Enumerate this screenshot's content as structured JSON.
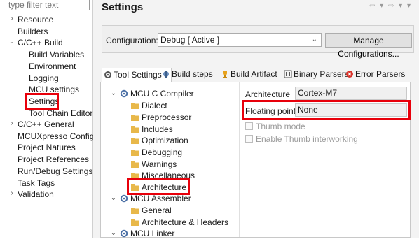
{
  "filter": {
    "placeholder": "type filter text"
  },
  "nav": {
    "items": [
      {
        "label": "Resource",
        "expander": "›"
      },
      {
        "label": "Builders"
      },
      {
        "label": "C/C++ Build",
        "expander": "⌄"
      },
      {
        "label": "Build Variables"
      },
      {
        "label": "Environment"
      },
      {
        "label": "Logging"
      },
      {
        "label": "MCU settings"
      },
      {
        "label": "Settings"
      },
      {
        "label": "Tool Chain Editor"
      },
      {
        "label": "C/C++ General",
        "expander": "›"
      },
      {
        "label": "MCUXpresso Config T"
      },
      {
        "label": "Project Natures"
      },
      {
        "label": "Project References"
      },
      {
        "label": "Run/Debug Settings"
      },
      {
        "label": "Task Tags"
      },
      {
        "label": "Validation",
        "expander": "›"
      }
    ]
  },
  "header": {
    "title": "Settings",
    "nav_icons": "⇦ ▾ ⇨ ▾ ▾"
  },
  "config": {
    "label": "Configuration:",
    "selected": "Debug  [ Active ]",
    "manage_label": "Manage Configurations..."
  },
  "tabs": [
    {
      "label": "Tool Settings",
      "icon": "settings-icon"
    },
    {
      "label": "Build steps",
      "icon": "build-steps-icon"
    },
    {
      "label": "Build Artifact",
      "icon": "trophy-icon"
    },
    {
      "label": "Binary Parsers",
      "icon": "binary-icon"
    },
    {
      "label": "Error Parsers",
      "icon": "error-icon"
    }
  ],
  "tree": {
    "items": [
      {
        "label": "MCU C Compiler",
        "expander": "⌄"
      },
      {
        "label": "Dialect"
      },
      {
        "label": "Preprocessor"
      },
      {
        "label": "Includes"
      },
      {
        "label": "Optimization"
      },
      {
        "label": "Debugging"
      },
      {
        "label": "Warnings"
      },
      {
        "label": "Miscellaneous"
      },
      {
        "label": "Architecture"
      },
      {
        "label": "MCU Assembler",
        "expander": "⌄"
      },
      {
        "label": "General"
      },
      {
        "label": "Architecture & Headers"
      },
      {
        "label": "MCU Linker",
        "expander": "⌄"
      }
    ]
  },
  "props": {
    "architecture_label": "Architecture",
    "architecture_value": "Cortex-M7",
    "floating_label": "Floating point",
    "floating_value": "None",
    "thumb_label": "Thumb mode",
    "interwork_label": "Enable Thumb interworking"
  },
  "colors": {
    "highlight": "#e8000b",
    "folder": "#e8b84a",
    "gear": "#4a6fa5"
  }
}
